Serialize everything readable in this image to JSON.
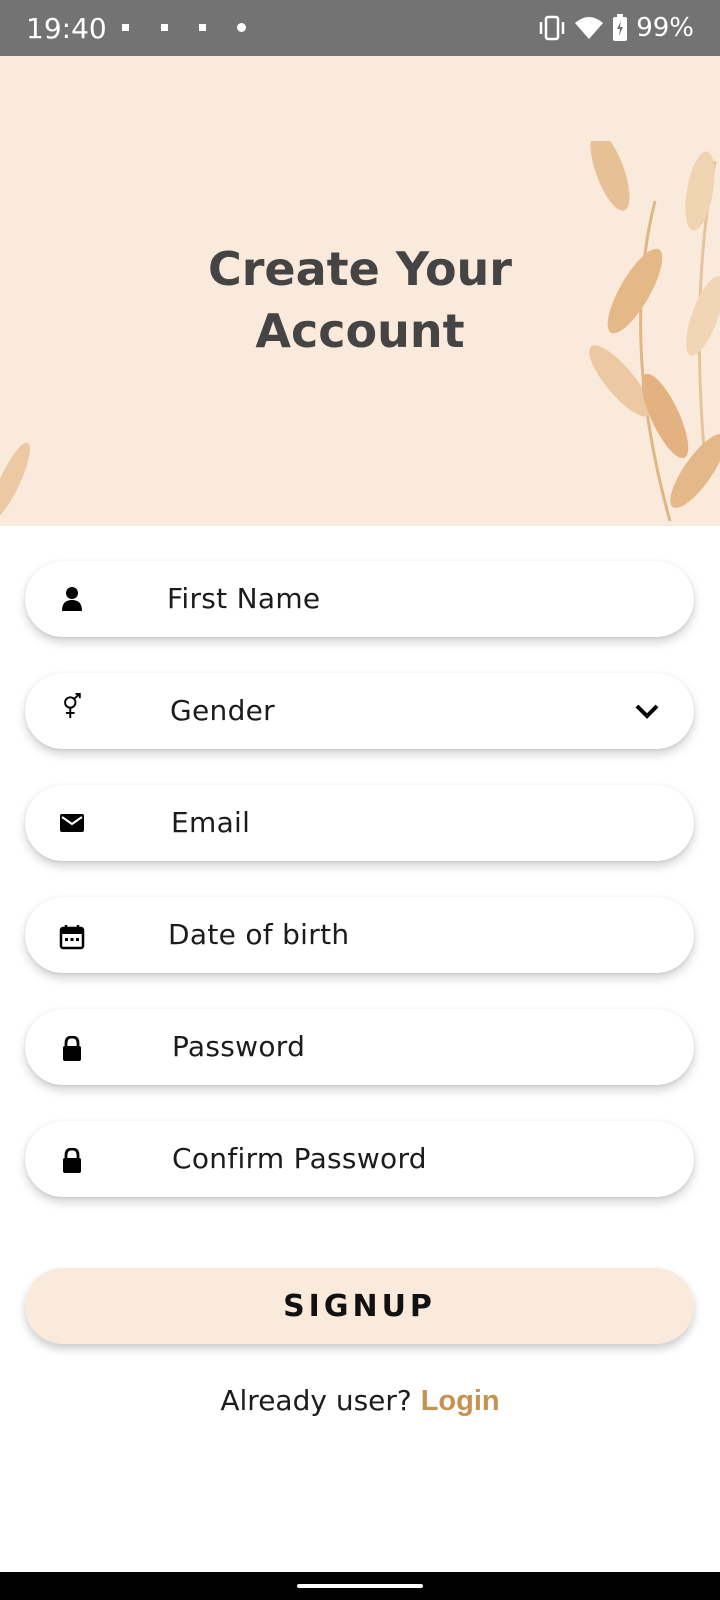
{
  "status_bar": {
    "time": "19:40",
    "battery": "99%",
    "icons": [
      "vibrate-icon",
      "wifi-icon",
      "battery-charging-icon"
    ]
  },
  "header": {
    "title_line1": "Create Your",
    "title_line2": "Account",
    "background_color": "#faeadb"
  },
  "form": {
    "first_name": "First Name",
    "gender": "Gender",
    "email": "Email",
    "date_of_birth": "Date of birth",
    "password": "Password",
    "confirm_password": "Confirm Password"
  },
  "signup_button": "SIGNUP",
  "footer": {
    "prompt": "Already user?",
    "login_link": "Login",
    "accent_color": "#c79150"
  }
}
